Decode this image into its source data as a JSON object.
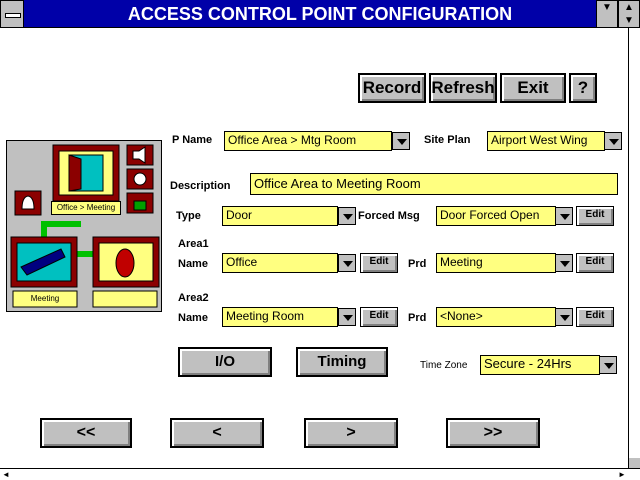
{
  "window": {
    "title": "ACCESS CONTROL POINT CONFIGURATION"
  },
  "toolbar": {
    "record": "Record",
    "refresh": "Refresh",
    "exit": "Exit",
    "help": "?"
  },
  "form": {
    "p_name_label": "P Name",
    "p_name_value": "Office Area > Mtg Room",
    "site_plan_label": "Site Plan",
    "site_plan_value": "Airport West Wing",
    "description_label": "Description",
    "description_value": "Office Area to Meeting Room",
    "type_label": "Type",
    "type_value": "Door",
    "forced_msg_label": "Forced Msg",
    "forced_msg_value": "Door Forced Open",
    "area1_label": "Area1",
    "area1_name_label": "Name",
    "area1_name_value": "Office",
    "area1_prd_label": "Prd",
    "area1_prd_value": "Meeting",
    "area2_label": "Area2",
    "area2_name_label": "Name",
    "area2_name_value": "Meeting Room",
    "area2_prd_label": "Prd",
    "area2_prd_value": "<None>",
    "edit_label": "Edit",
    "timezone_label": "Time Zone",
    "timezone_value": "Secure - 24Hrs"
  },
  "actions": {
    "io": "I/O",
    "timing": "Timing"
  },
  "nav": {
    "first": "<<",
    "prev": "<",
    "next": ">",
    "last": ">>"
  },
  "diagram": {
    "door_label": "Office > Meeting",
    "area_label": "Meeting"
  },
  "colors": {
    "titlebar": "#0000a8",
    "field": "#ffff80",
    "panel": "#c0c0c0",
    "frame": "#8b0000"
  }
}
